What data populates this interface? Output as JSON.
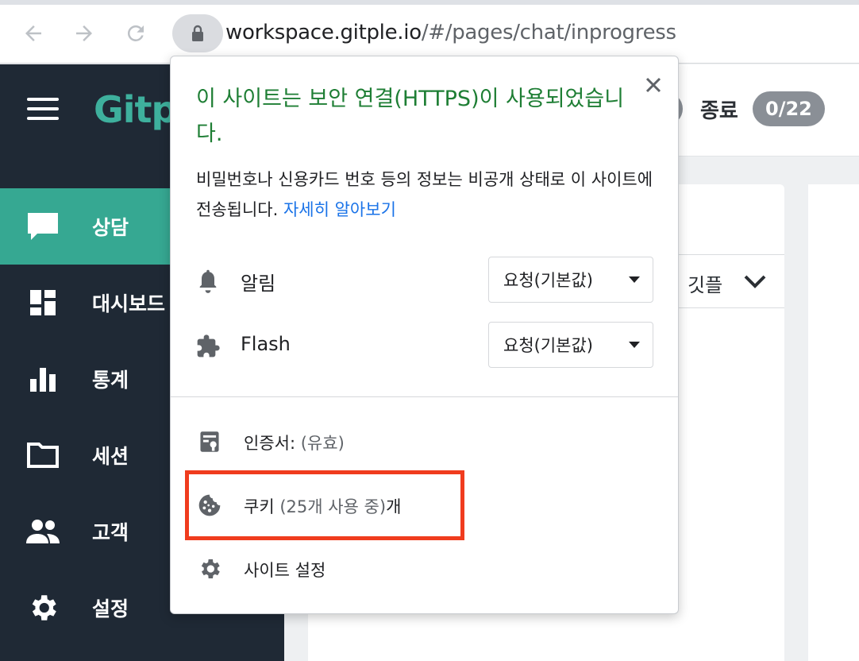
{
  "browser": {
    "url_host": "workspace.gitple.io",
    "url_path": "/#/pages/chat/inprogress",
    "icons": {
      "back": "arrow-left-icon",
      "forward": "arrow-right-icon",
      "reload": "reload-icon",
      "lock": "lock-icon"
    }
  },
  "sidebar": {
    "logo": "Gitp",
    "items": [
      {
        "label": "상담",
        "icon": "chat-icon",
        "active": true
      },
      {
        "label": "대시보드",
        "icon": "dashboard-icon",
        "active": false
      },
      {
        "label": "통계",
        "icon": "bar-chart-icon",
        "active": false
      },
      {
        "label": "세션",
        "icon": "folder-icon",
        "active": false
      },
      {
        "label": "고객",
        "icon": "people-icon",
        "active": false
      },
      {
        "label": "설정",
        "icon": "gear-icon",
        "active": false
      }
    ]
  },
  "header": {
    "close_label": "종료",
    "close_count": "0/22"
  },
  "panel": {
    "selected": "깃플"
  },
  "popup": {
    "title": "이 사이트는 보안 연결(HTTPS)이 사용되었습니다.",
    "desc": "비밀번호나 신용카드 번호 등의 정보는 비공개 상태로 이 사이트에 전송됩니다.",
    "learn_more": "자세히 알아보기",
    "permissions": [
      {
        "label": "알림",
        "icon": "bell-icon",
        "value": "요청(기본값)"
      },
      {
        "label": "Flash",
        "icon": "puzzle-icon",
        "value": "요청(기본값)"
      }
    ],
    "certificate": {
      "label": "인증서:",
      "sub": "(유효)"
    },
    "cookies": {
      "label": "쿠키",
      "sub": "(25개 사용 중)",
      "suffix": "개"
    },
    "site_settings": "사이트 설정"
  },
  "colors": {
    "sidebar_bg": "#1f2935",
    "accent": "#36a892",
    "secure_green": "#1e7e34",
    "link_blue": "#1a73e8",
    "highlight_red": "#f03c1e"
  }
}
